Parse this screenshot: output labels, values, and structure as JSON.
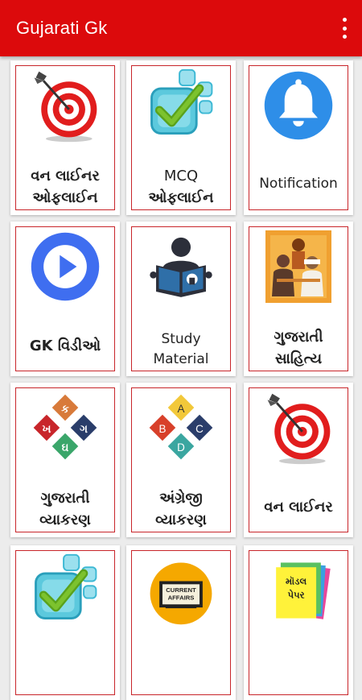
{
  "app": {
    "title": "Gujarati Gk"
  },
  "cards": [
    {
      "line1": "વન લાઈનર",
      "line2": "ઓફલાઈન",
      "icon": "target-dart-icon"
    },
    {
      "line1": "MCQ",
      "line2": "ઓફલાઈન",
      "icon": "checkbox-tiles-icon"
    },
    {
      "line1": "Notification",
      "line2": "",
      "icon": "bell-icon"
    },
    {
      "line1": "GK વિડીઓ",
      "line2": "",
      "icon": "play-icon"
    },
    {
      "line1": "Study",
      "line2": "Material",
      "icon": "reading-book-icon"
    },
    {
      "line1": "ગુજરાતી",
      "line2": "સાહિત્ય",
      "icon": "poets-photo-icon"
    },
    {
      "line1": "ગુજરાતી",
      "line2": "વ્યાકરણ",
      "icon": "gujarati-letters-diamond-icon",
      "letters": [
        "ક",
        "ખ",
        "ગ",
        "ઘ"
      ]
    },
    {
      "line1": "અંગ્રેજી",
      "line2": "વ્યાકરણ",
      "icon": "abcd-diamond-icon",
      "letters": [
        "A",
        "B",
        "C",
        "D"
      ]
    },
    {
      "line1": "વન લાઈનર",
      "line2": "",
      "icon": "target-dart-icon"
    },
    {
      "line1": "",
      "line2": "",
      "icon": "checkbox-tiles-icon"
    },
    {
      "line1": "",
      "line2": "",
      "icon": "current-affairs-icon",
      "badge_text": [
        "CURRENT",
        "AFFAIRS"
      ]
    },
    {
      "line1": "",
      "line2": "",
      "icon": "model-paper-icon",
      "badge_text": [
        "મૉડલ",
        "પેપર"
      ]
    }
  ],
  "colors": {
    "appbar": "#dc0a0c",
    "card_border": "#c8252a",
    "background": "#ececec"
  }
}
